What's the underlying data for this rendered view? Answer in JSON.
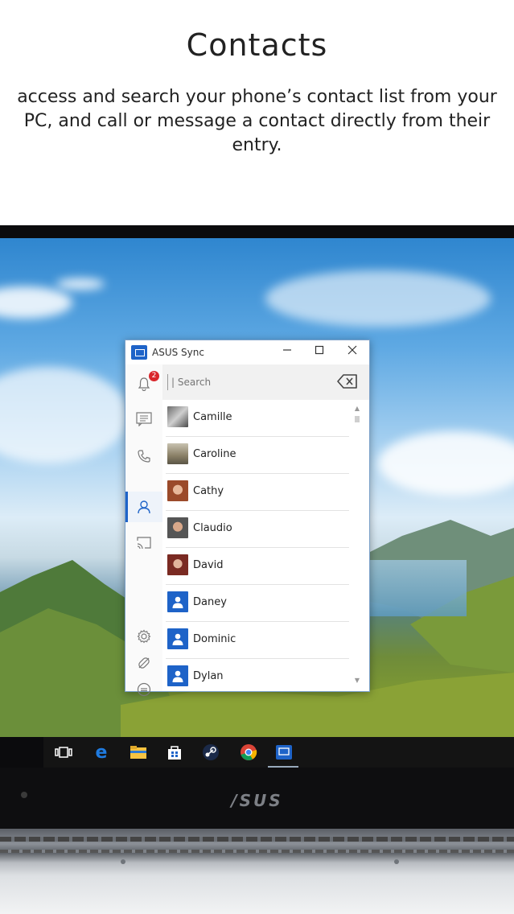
{
  "promo": {
    "title": "Contacts",
    "description": "access and search your phone’s contact list from your PC, and call or message a contact directly from their entry."
  },
  "app": {
    "title": "ASUS Sync",
    "window_controls": [
      "minimize",
      "maximize",
      "close"
    ],
    "notification_badge": "2",
    "search_placeholder": "| Search",
    "sidebar": [
      "bell-icon",
      "message-icon",
      "phone-icon",
      "contacts-icon",
      "cast-icon",
      "settings-icon",
      "link-icon",
      "minus-circle-icon"
    ],
    "active_sidebar_item": "contacts",
    "contacts": [
      {
        "name": "Camille",
        "avatar": "photo"
      },
      {
        "name": "Caroline",
        "avatar": "photo"
      },
      {
        "name": "Cathy",
        "avatar": "photo"
      },
      {
        "name": "Claudio",
        "avatar": "photo"
      },
      {
        "name": "David",
        "avatar": "photo"
      },
      {
        "name": "Daney",
        "avatar": "default"
      },
      {
        "name": "Dominic",
        "avatar": "default"
      },
      {
        "name": "Dylan",
        "avatar": "default"
      }
    ]
  },
  "taskbar": {
    "icons": [
      "task-view-icon",
      "edge-icon",
      "file-explorer-icon",
      "store-icon",
      "steam-icon",
      "chrome-icon",
      "asus-sync-icon"
    ]
  },
  "laptop": {
    "brand": "/SUS"
  },
  "colors": {
    "accent": "#1e63c8",
    "badge": "#d9262b"
  }
}
